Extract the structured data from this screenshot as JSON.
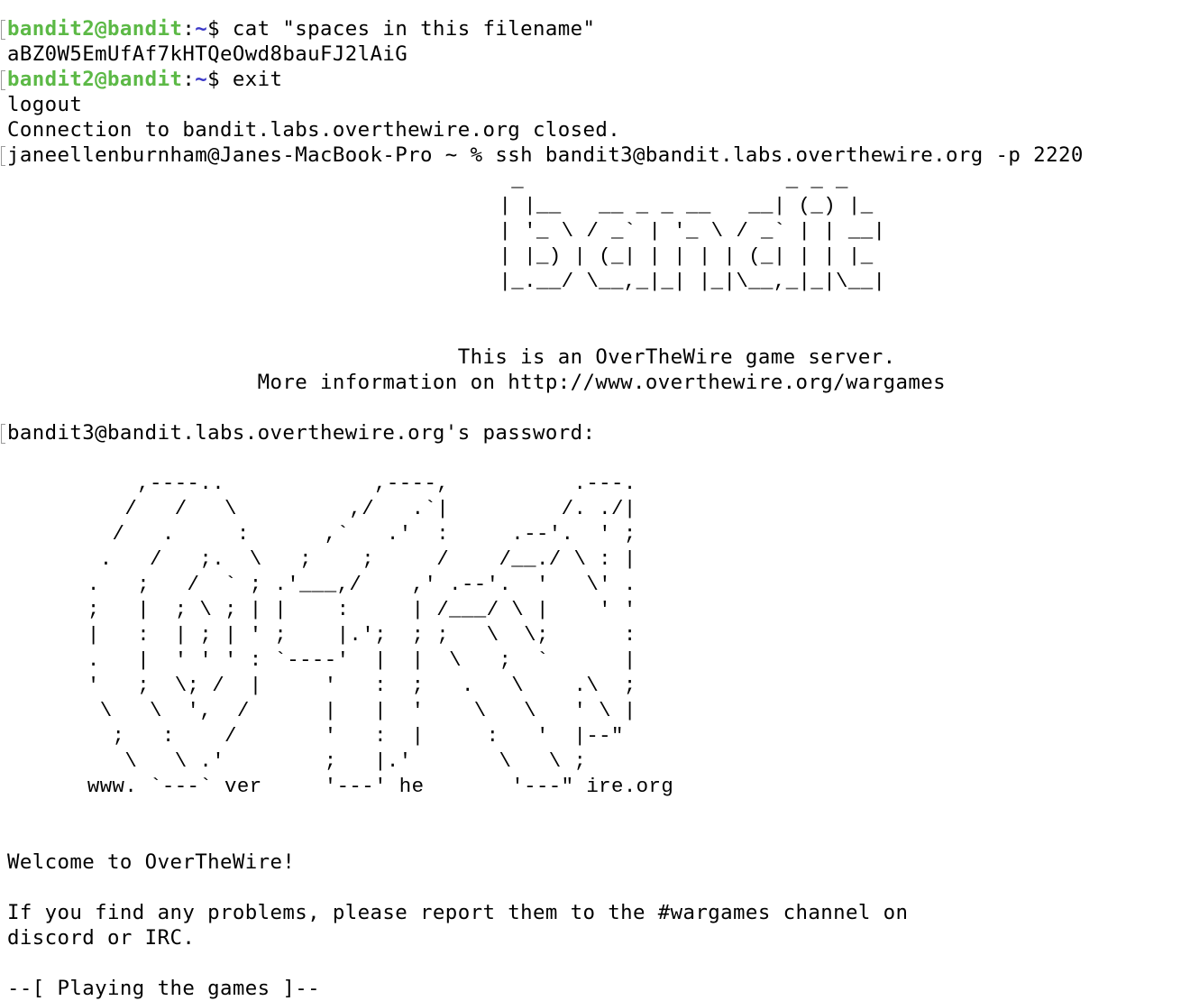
{
  "session": {
    "line1": {
      "user": "bandit2@bandit",
      "colon": ":",
      "path": "~",
      "rest": "$ cat \"spaces in this filename\""
    },
    "line2": "aBZ0W5EmUfAf7kHTQeOwd8bauFJ2lAiG",
    "line3": {
      "user": "bandit2@bandit",
      "colon": ":",
      "path": "~",
      "rest": "$ exit"
    },
    "line4": "logout",
    "line5": "Connection to bandit.labs.overthewire.org closed.",
    "line6": "janeellenburnham@Janes-MacBook-Pro ~ % ssh bandit3@bandit.labs.overthewire.org -p 2220"
  },
  "banner": {
    "art": "                                         _                     _ _ _\n                                        | |__   __ _ _ __   __| (_) |_\n                                        | '_ \\ / _` | '_ \\ / _` | | __|\n                                        | |_) | (_| | | | | (_| | | |_\n                                        |_.__/ \\__,_|_| |_|\\__,_|_|\\__|",
    "line1": "                                    This is an OverTheWire game server.",
    "line2": "                    More information on http://www.overthewire.org/wargames"
  },
  "password_prompt": "bandit3@bandit.labs.overthewire.org's password:",
  "logo_art": "           ,----..            ,----,          .---.\n          /   /   \\         ,/   .`|         /. ./|\n         /   .     :      ,`   .'  :     .--'.  ' ;\n        .   /   ;.  \\   ;    ;     /    /__./ \\ : |\n       .   ;   /  ` ; .'___,/    ,' .--'.  '   \\' .\n       ;   |  ; \\ ; | |    :     | /___/ \\ |    ' '\n       |   :  | ; | ' ;    |.';  ; ;   \\  \\;      :\n       .   |  ' ' ' : `----'  |  |  \\   ;  `      |\n       '   ;  \\; /  |     '   :  ;   .   \\    .\\  ;\n        \\   \\  ',  /      |   |  '    \\   \\   ' \\ |\n         ;   :    /       '   :  |     :   '  |--\"\n          \\   \\ .'        ;   |.'       \\   \\ ;\n       www. `---` ver     '---' he       '---\" ire.org",
  "welcome": "Welcome to OverTheWire!",
  "report_line1": "If you find any problems, please report them to the #wargames channel on",
  "report_line2": "discord or IRC.",
  "section_heading": "--[ Playing the games ]--"
}
